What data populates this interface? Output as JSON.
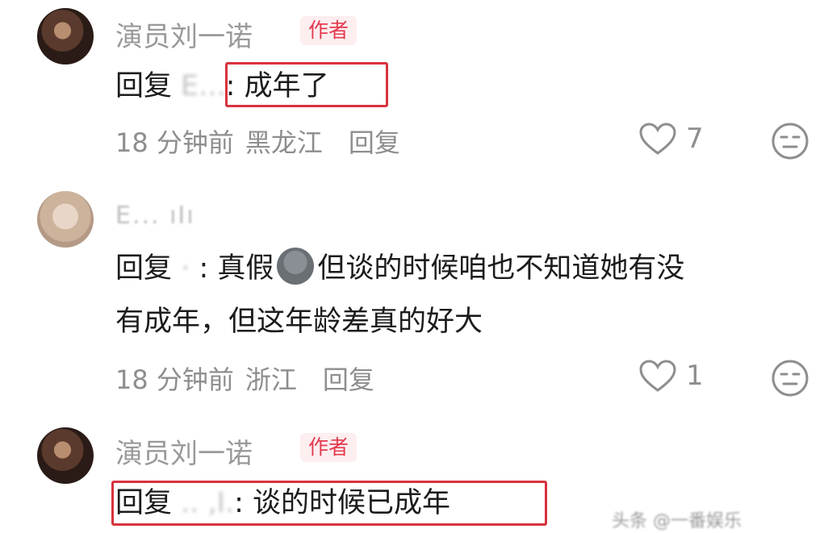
{
  "comments": [
    {
      "username": "演员刘一诺",
      "badge": "作者",
      "reply_prefix": "回复",
      "reply_target": "E...",
      "reply_sep": ":",
      "text": "成年了",
      "time": "18 分钟前",
      "location": "黑龙江",
      "reply_label": "回复",
      "likes": "7"
    },
    {
      "username": "E... ıIı",
      "reply_prefix": "回复",
      "reply_target": "·",
      "reply_sep": ":",
      "text_line1": "真假",
      "text_line1b": "但谈的时候咱也不知道她有没",
      "text_line2": "有成年，但这年龄差真的好大",
      "time": "18 分钟前",
      "location": "浙江",
      "reply_label": "回复",
      "likes": "1"
    },
    {
      "username": "演员刘一诺",
      "badge": "作者",
      "reply_prefix": "回复",
      "reply_target": ".. ,I.",
      "reply_sep": ":",
      "text": "谈的时候已成年"
    }
  ],
  "icons": {
    "like": "heart-icon",
    "emoji": "emoji-face-icon",
    "sticker": "crying-sticker-icon"
  },
  "colors": {
    "highlight_box": "#d8323f",
    "author_badge": "#e33a4f"
  },
  "watermark": "头条 @一番娱乐"
}
